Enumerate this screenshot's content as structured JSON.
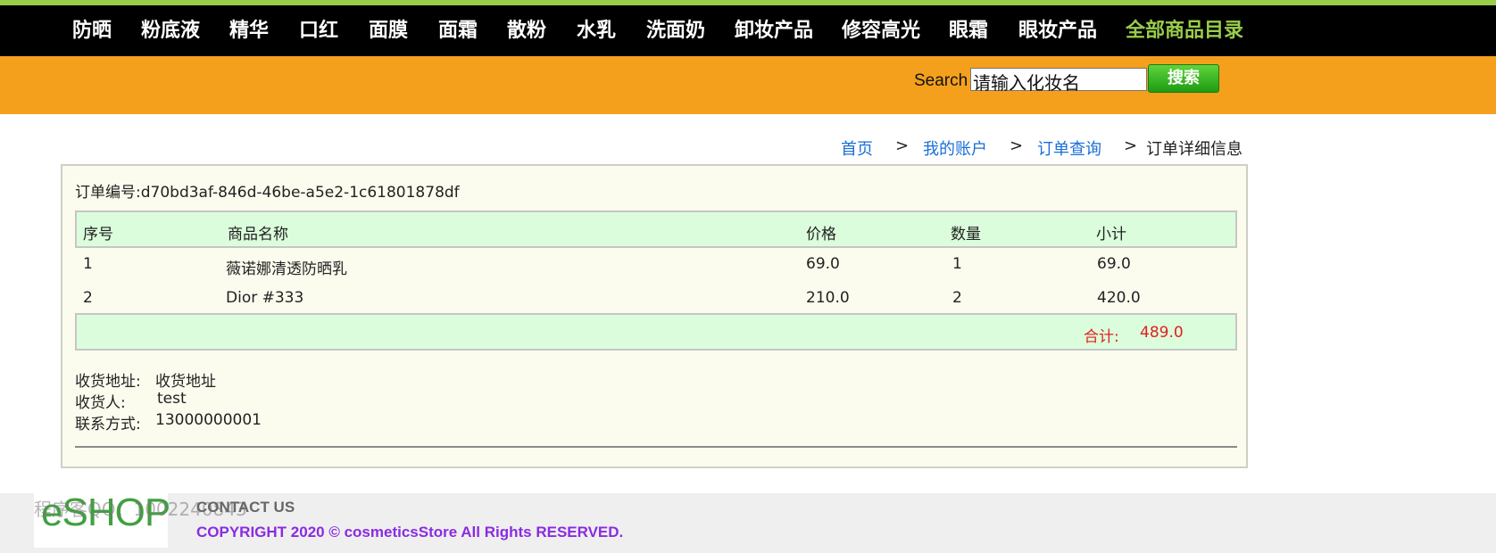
{
  "nav": {
    "items": [
      "防晒",
      "粉底液",
      "精华",
      "口红",
      "面膜",
      "面霜",
      "散粉",
      "水乳",
      "洗面奶",
      "卸妆产品",
      "修容高光",
      "眼霜",
      "眼妆产品"
    ],
    "all_label": "全部商品目录"
  },
  "search": {
    "label": "Search",
    "value": "请输入化妆名",
    "button": "搜索"
  },
  "breadcrumb": {
    "home": "首页",
    "account": "我的账户",
    "orders": "订单查询",
    "current": "订单详细信息",
    "sep": ">"
  },
  "order": {
    "number_label": "订单编号:",
    "number": "d70bd3af-846d-46be-a5e2-1c61801878df",
    "columns": [
      "序号",
      "商品名称",
      "价格",
      "数量",
      "小计"
    ],
    "rows": [
      [
        "1",
        "薇诺娜清透防晒乳",
        "69.0",
        "1",
        "69.0"
      ],
      [
        "2",
        "Dior #333",
        "210.0",
        "2",
        "420.0"
      ]
    ],
    "total_label": "合计:",
    "total_value": "489.0",
    "address_label": "收货地址:",
    "address": "收货地址",
    "receiver_label": "收货人:",
    "receiver": "test",
    "phone_label": "联系方式:",
    "phone": "13000000001"
  },
  "footer": {
    "logo": "eSHOP",
    "watermark": "程序客QQ：1002240843",
    "contact": "CONTACT US",
    "copyright": "COPYRIGHT 2020 © cosmeticsStore All Rights RESERVED."
  },
  "colors": {
    "nav_bg": "#000000",
    "accent_green": "#9acd4a",
    "search_bar": "#f4a01d",
    "table_head_bg": "#dbfddc",
    "total_red": "#e02020",
    "link_blue": "#1a6ed8",
    "copyright_purple": "#8a2be2"
  }
}
